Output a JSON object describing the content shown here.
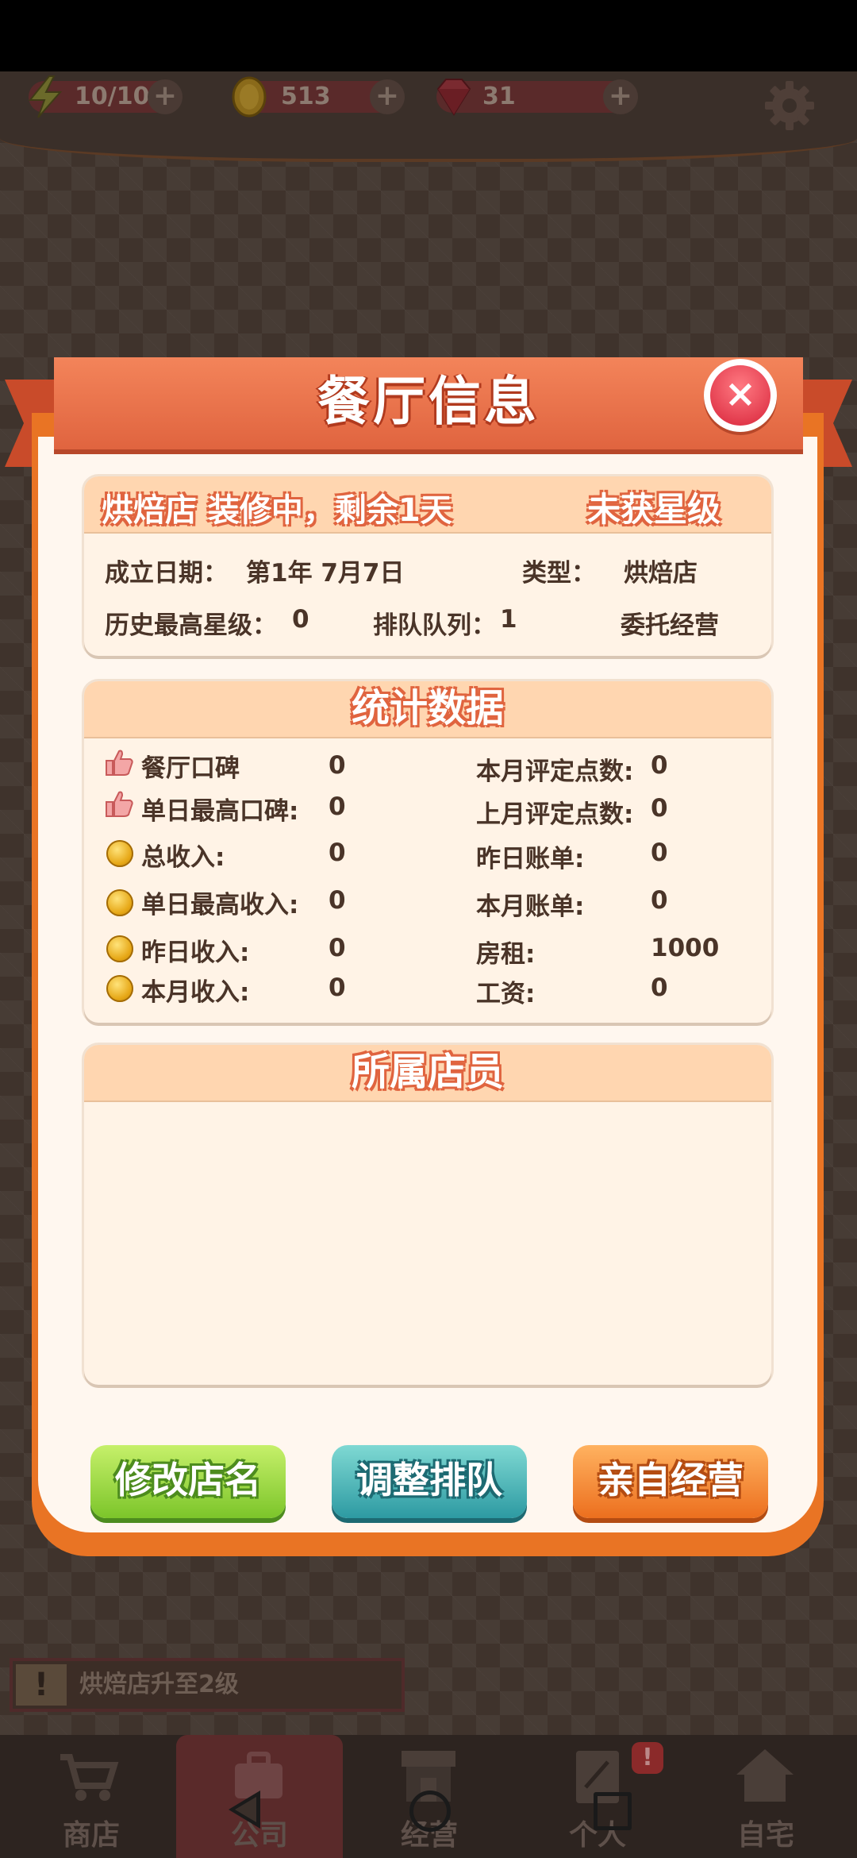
{
  "topbar": {
    "energy": "10/10",
    "coins": "513",
    "gems": "31",
    "plus": "+"
  },
  "dialog": {
    "title": "餐厅信息",
    "close": "×",
    "info": {
      "status": "烘焙店 装修中，剩余1天",
      "rating": "未获星级",
      "founded_label": "成立日期：",
      "founded_value": "第1年 7月7日",
      "type_label": "类型：",
      "type_value": "烘焙店",
      "best_star_label": "历史最高星级：",
      "best_star_value": "0",
      "queue_label": "排队队列：",
      "queue_value": "1",
      "mode": "委托经营"
    },
    "stats": {
      "title": "统计数据",
      "left": [
        {
          "label": "餐厅口碑",
          "value": "0",
          "icon": "thumbs-up-icon"
        },
        {
          "label": "单日最高口碑:",
          "value": "0",
          "icon": "thumbs-up-icon"
        },
        {
          "label": "总收入:",
          "value": "0",
          "icon": "coin-icon"
        },
        {
          "label": "单日最高收入:",
          "value": "0",
          "icon": "coin-icon"
        },
        {
          "label": "昨日收入:",
          "value": "0",
          "icon": "coin-icon"
        },
        {
          "label": "本月收入:",
          "value": "0",
          "icon": "coin-icon"
        }
      ],
      "right": [
        {
          "label": "本月评定点数:",
          "value": "0"
        },
        {
          "label": "上月评定点数:",
          "value": "0"
        },
        {
          "label": "昨日账单:",
          "value": "0"
        },
        {
          "label": "本月账单:",
          "value": "0"
        },
        {
          "label": "房租:",
          "value": "1000"
        },
        {
          "label": "工资:",
          "value": "0"
        }
      ]
    },
    "staff": {
      "title": "所属店员"
    },
    "buttons": {
      "rename": "修改店名",
      "queue": "调整排队",
      "manage": "亲自经营"
    }
  },
  "quest": {
    "text": "烘焙店升至2级",
    "icon": "!"
  },
  "tabs": [
    {
      "label": "商店"
    },
    {
      "label": "公司"
    },
    {
      "label": "经营"
    },
    {
      "label": "个人"
    },
    {
      "label": "自宅"
    }
  ],
  "badge": "!",
  "colors": {
    "accent": "#e0643f",
    "modal_border": "#e97424",
    "panel": "#fff3e6"
  }
}
